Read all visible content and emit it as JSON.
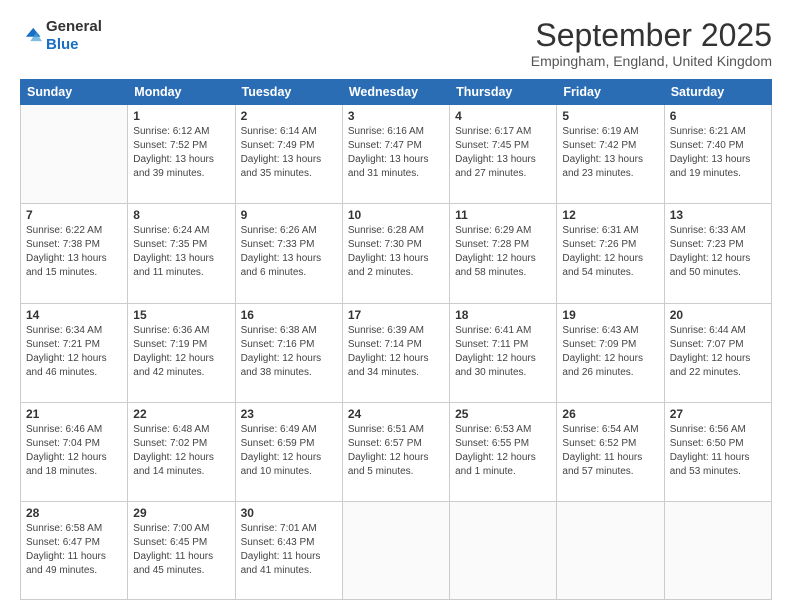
{
  "header": {
    "logo_general": "General",
    "logo_blue": "Blue",
    "month_title": "September 2025",
    "location": "Empingham, England, United Kingdom"
  },
  "days_of_week": [
    "Sunday",
    "Monday",
    "Tuesday",
    "Wednesday",
    "Thursday",
    "Friday",
    "Saturday"
  ],
  "weeks": [
    [
      {
        "day": "",
        "content": ""
      },
      {
        "day": "1",
        "content": "Sunrise: 6:12 AM\nSunset: 7:52 PM\nDaylight: 13 hours\nand 39 minutes."
      },
      {
        "day": "2",
        "content": "Sunrise: 6:14 AM\nSunset: 7:49 PM\nDaylight: 13 hours\nand 35 minutes."
      },
      {
        "day": "3",
        "content": "Sunrise: 6:16 AM\nSunset: 7:47 PM\nDaylight: 13 hours\nand 31 minutes."
      },
      {
        "day": "4",
        "content": "Sunrise: 6:17 AM\nSunset: 7:45 PM\nDaylight: 13 hours\nand 27 minutes."
      },
      {
        "day": "5",
        "content": "Sunrise: 6:19 AM\nSunset: 7:42 PM\nDaylight: 13 hours\nand 23 minutes."
      },
      {
        "day": "6",
        "content": "Sunrise: 6:21 AM\nSunset: 7:40 PM\nDaylight: 13 hours\nand 19 minutes."
      }
    ],
    [
      {
        "day": "7",
        "content": "Sunrise: 6:22 AM\nSunset: 7:38 PM\nDaylight: 13 hours\nand 15 minutes."
      },
      {
        "day": "8",
        "content": "Sunrise: 6:24 AM\nSunset: 7:35 PM\nDaylight: 13 hours\nand 11 minutes."
      },
      {
        "day": "9",
        "content": "Sunrise: 6:26 AM\nSunset: 7:33 PM\nDaylight: 13 hours\nand 6 minutes."
      },
      {
        "day": "10",
        "content": "Sunrise: 6:28 AM\nSunset: 7:30 PM\nDaylight: 13 hours\nand 2 minutes."
      },
      {
        "day": "11",
        "content": "Sunrise: 6:29 AM\nSunset: 7:28 PM\nDaylight: 12 hours\nand 58 minutes."
      },
      {
        "day": "12",
        "content": "Sunrise: 6:31 AM\nSunset: 7:26 PM\nDaylight: 12 hours\nand 54 minutes."
      },
      {
        "day": "13",
        "content": "Sunrise: 6:33 AM\nSunset: 7:23 PM\nDaylight: 12 hours\nand 50 minutes."
      }
    ],
    [
      {
        "day": "14",
        "content": "Sunrise: 6:34 AM\nSunset: 7:21 PM\nDaylight: 12 hours\nand 46 minutes."
      },
      {
        "day": "15",
        "content": "Sunrise: 6:36 AM\nSunset: 7:19 PM\nDaylight: 12 hours\nand 42 minutes."
      },
      {
        "day": "16",
        "content": "Sunrise: 6:38 AM\nSunset: 7:16 PM\nDaylight: 12 hours\nand 38 minutes."
      },
      {
        "day": "17",
        "content": "Sunrise: 6:39 AM\nSunset: 7:14 PM\nDaylight: 12 hours\nand 34 minutes."
      },
      {
        "day": "18",
        "content": "Sunrise: 6:41 AM\nSunset: 7:11 PM\nDaylight: 12 hours\nand 30 minutes."
      },
      {
        "day": "19",
        "content": "Sunrise: 6:43 AM\nSunset: 7:09 PM\nDaylight: 12 hours\nand 26 minutes."
      },
      {
        "day": "20",
        "content": "Sunrise: 6:44 AM\nSunset: 7:07 PM\nDaylight: 12 hours\nand 22 minutes."
      }
    ],
    [
      {
        "day": "21",
        "content": "Sunrise: 6:46 AM\nSunset: 7:04 PM\nDaylight: 12 hours\nand 18 minutes."
      },
      {
        "day": "22",
        "content": "Sunrise: 6:48 AM\nSunset: 7:02 PM\nDaylight: 12 hours\nand 14 minutes."
      },
      {
        "day": "23",
        "content": "Sunrise: 6:49 AM\nSunset: 6:59 PM\nDaylight: 12 hours\nand 10 minutes."
      },
      {
        "day": "24",
        "content": "Sunrise: 6:51 AM\nSunset: 6:57 PM\nDaylight: 12 hours\nand 5 minutes."
      },
      {
        "day": "25",
        "content": "Sunrise: 6:53 AM\nSunset: 6:55 PM\nDaylight: 12 hours\nand 1 minute."
      },
      {
        "day": "26",
        "content": "Sunrise: 6:54 AM\nSunset: 6:52 PM\nDaylight: 11 hours\nand 57 minutes."
      },
      {
        "day": "27",
        "content": "Sunrise: 6:56 AM\nSunset: 6:50 PM\nDaylight: 11 hours\nand 53 minutes."
      }
    ],
    [
      {
        "day": "28",
        "content": "Sunrise: 6:58 AM\nSunset: 6:47 PM\nDaylight: 11 hours\nand 49 minutes."
      },
      {
        "day": "29",
        "content": "Sunrise: 7:00 AM\nSunset: 6:45 PM\nDaylight: 11 hours\nand 45 minutes."
      },
      {
        "day": "30",
        "content": "Sunrise: 7:01 AM\nSunset: 6:43 PM\nDaylight: 11 hours\nand 41 minutes."
      },
      {
        "day": "",
        "content": ""
      },
      {
        "day": "",
        "content": ""
      },
      {
        "day": "",
        "content": ""
      },
      {
        "day": "",
        "content": ""
      }
    ]
  ]
}
